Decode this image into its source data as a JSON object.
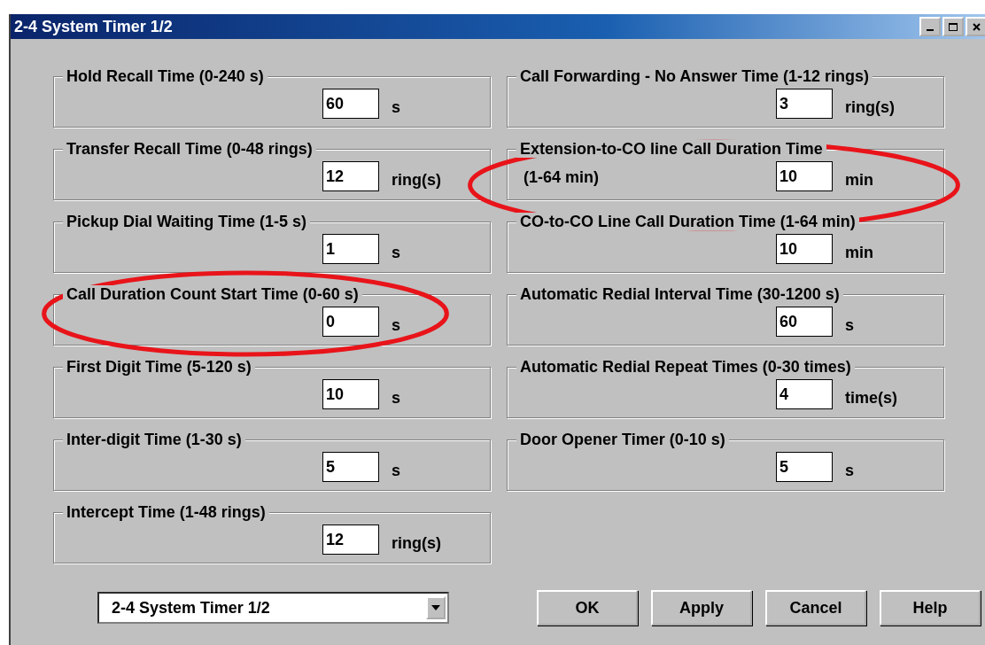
{
  "window": {
    "title": "2-4 System Timer 1/2"
  },
  "columns": [
    [
      {
        "label": "Hold Recall Time (0-240 s)",
        "value": "60",
        "unit": "s",
        "highlighted": false
      },
      {
        "label": "Transfer Recall Time (0-48 rings)",
        "value": "12",
        "unit": "ring(s)",
        "highlighted": false
      },
      {
        "label": "Pickup Dial Waiting Time (1-5 s)",
        "value": "1",
        "unit": "s",
        "highlighted": false
      },
      {
        "label": "Call Duration Count Start Time (0-60 s)",
        "value": "0",
        "unit": "s",
        "highlighted": true
      },
      {
        "label": "First Digit Time (5-120 s)",
        "value": "10",
        "unit": "s",
        "highlighted": false
      },
      {
        "label": "Inter-digit Time (1-30 s)",
        "value": "5",
        "unit": "s",
        "highlighted": false
      },
      {
        "label": "Intercept Time (1-48 rings)",
        "value": "12",
        "unit": "ring(s)",
        "highlighted": false
      }
    ],
    [
      {
        "label": "Call Forwarding - No Answer Time (1-12 rings)",
        "value": "3",
        "unit": "ring(s)",
        "highlighted": false
      },
      {
        "label": "Extension-to-CO line Call Duration Time",
        "label_line_2": "(1-64 min)",
        "value": "10",
        "unit": "min",
        "highlighted": true
      },
      {
        "label": "CO-to-CO Line Call Duration Time (1-64 min)",
        "value": "10",
        "unit": "min",
        "highlighted": false
      },
      {
        "label": "Automatic Redial Interval Time (30-1200 s)",
        "value": "60",
        "unit": "s",
        "highlighted": false
      },
      {
        "label": "Automatic Redial Repeat Times (0-30 times)",
        "value": "4",
        "unit": "time(s)",
        "highlighted": false
      },
      {
        "label": "Door Opener Timer (0-10 s)",
        "value": "5",
        "unit": "s",
        "highlighted": false
      }
    ]
  ],
  "page_select": {
    "value": "2-4 System Timer 1/2"
  },
  "buttons": [
    "OK",
    "Apply",
    "Cancel",
    "Help"
  ]
}
